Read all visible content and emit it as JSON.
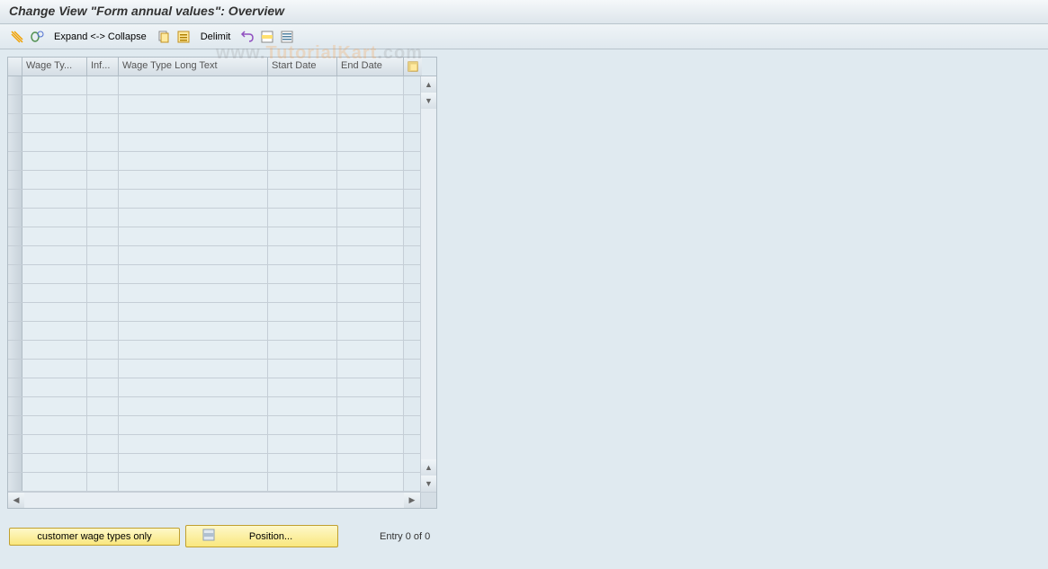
{
  "title": "Change View \"Form annual values\": Overview",
  "toolbar": {
    "expand_collapse": "Expand <-> Collapse",
    "delimit": "Delimit"
  },
  "table": {
    "columns": {
      "wage_ty": "Wage Ty...",
      "inf": "Inf...",
      "long_text": "Wage Type Long Text",
      "start_date": "Start Date",
      "end_date": "End Date"
    },
    "rows": []
  },
  "bottom": {
    "customer_btn": "customer wage types only",
    "position_btn": "Position...",
    "entry_status": "Entry 0 of 0"
  },
  "watermark": {
    "part1": "www.",
    "part2": "TutorialKart",
    "part3": ".com"
  }
}
